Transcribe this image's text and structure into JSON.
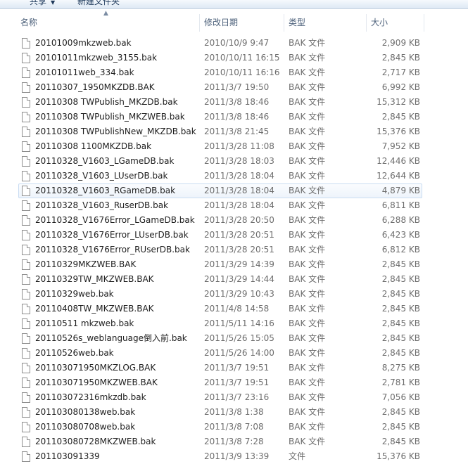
{
  "toolbar": {
    "share_label": "共享",
    "new_folder_label": "新建文件夹"
  },
  "columns": {
    "name": "名称",
    "date": "修改日期",
    "type": "类型",
    "size": "大小"
  },
  "selected_row": 10,
  "files": [
    {
      "name": "20101009mkzweb.bak",
      "date": "2010/10/9 9:47",
      "type": "BAK 文件",
      "size": "2,909 KB"
    },
    {
      "name": "20101011mkzweb_3155.bak",
      "date": "2010/10/11 16:15",
      "type": "BAK 文件",
      "size": "2,845 KB"
    },
    {
      "name": "20101011web_334.bak",
      "date": "2010/10/11 16:16",
      "type": "BAK 文件",
      "size": "2,717 KB"
    },
    {
      "name": "20110307_1950MKZDB.BAK",
      "date": "2011/3/7 19:50",
      "type": "BAK 文件",
      "size": "6,992 KB"
    },
    {
      "name": "20110308  TWPublish_MKZDB.bak",
      "date": "2011/3/8 18:46",
      "type": "BAK 文件",
      "size": "15,312 KB"
    },
    {
      "name": "20110308  TWPublish_MKZWEB.bak",
      "date": "2011/3/8 18:46",
      "type": "BAK 文件",
      "size": "2,845 KB"
    },
    {
      "name": "20110308  TWPublishNew_MKZDB.bak",
      "date": "2011/3/8 21:45",
      "type": "BAK 文件",
      "size": "15,376 KB"
    },
    {
      "name": "20110308 1100MKZDB.bak",
      "date": "2011/3/28 11:08",
      "type": "BAK 文件",
      "size": "7,952 KB"
    },
    {
      "name": "20110328_V1603_LGameDB.bak",
      "date": "2011/3/28 18:03",
      "type": "BAK 文件",
      "size": "12,446 KB"
    },
    {
      "name": "20110328_V1603_LUserDB.bak",
      "date": "2011/3/28 18:04",
      "type": "BAK 文件",
      "size": "12,644 KB"
    },
    {
      "name": "20110328_V1603_RGameDB.bak",
      "date": "2011/3/28 18:04",
      "type": "BAK 文件",
      "size": "4,879 KB"
    },
    {
      "name": "20110328_V1603_RuserDB.bak",
      "date": "2011/3/28 18:04",
      "type": "BAK 文件",
      "size": "6,811 KB"
    },
    {
      "name": "20110328_V1676Error_LGameDB.bak",
      "date": "2011/3/28 20:50",
      "type": "BAK 文件",
      "size": "6,288 KB"
    },
    {
      "name": "20110328_V1676Error_LUserDB.bak",
      "date": "2011/3/28 20:51",
      "type": "BAK 文件",
      "size": "6,423 KB"
    },
    {
      "name": "20110328_V1676Error_RUserDB.bak",
      "date": "2011/3/28 20:51",
      "type": "BAK 文件",
      "size": "6,812 KB"
    },
    {
      "name": "20110329MKZWEB.BAK",
      "date": "2011/3/29 14:39",
      "type": "BAK 文件",
      "size": "2,845 KB"
    },
    {
      "name": "20110329TW_MKZWEB.BAK",
      "date": "2011/3/29 14:44",
      "type": "BAK 文件",
      "size": "2,845 KB"
    },
    {
      "name": "20110329web.bak",
      "date": "2011/3/29 10:43",
      "type": "BAK 文件",
      "size": "2,845 KB"
    },
    {
      "name": "20110408TW_MKZWEB.BAK",
      "date": "2011/4/8 14:58",
      "type": "BAK 文件",
      "size": "2,845 KB"
    },
    {
      "name": "20110511 mkzweb.bak",
      "date": "2011/5/11 14:16",
      "type": "BAK 文件",
      "size": "2,845 KB"
    },
    {
      "name": "20110526s_weblanguage倒入前.bak",
      "date": "2011/5/26 15:05",
      "type": "BAK 文件",
      "size": "2,845 KB"
    },
    {
      "name": "20110526web.bak",
      "date": "2011/5/26 14:00",
      "type": "BAK 文件",
      "size": "2,845 KB"
    },
    {
      "name": "201103071950MKZLOG.BAK",
      "date": "2011/3/7 19:51",
      "type": "BAK 文件",
      "size": "8,275 KB"
    },
    {
      "name": "201103071950MKZWEB.BAK",
      "date": "2011/3/7 19:51",
      "type": "BAK 文件",
      "size": "2,781 KB"
    },
    {
      "name": "201103072316mkzdb.bak",
      "date": "2011/3/7 23:16",
      "type": "BAK 文件",
      "size": "7,056 KB"
    },
    {
      "name": "201103080138web.bak",
      "date": "2011/3/8 1:38",
      "type": "BAK 文件",
      "size": "2,845 KB"
    },
    {
      "name": "201103080708web.bak",
      "date": "2011/3/8 7:08",
      "type": "BAK 文件",
      "size": "2,845 KB"
    },
    {
      "name": "201103080728MKZWEB.bak",
      "date": "2011/3/8 7:28",
      "type": "BAK 文件",
      "size": "2,845 KB"
    },
    {
      "name": "201103091339",
      "date": "2011/3/9 13:39",
      "type": "文件",
      "size": "15,376 KB"
    }
  ]
}
